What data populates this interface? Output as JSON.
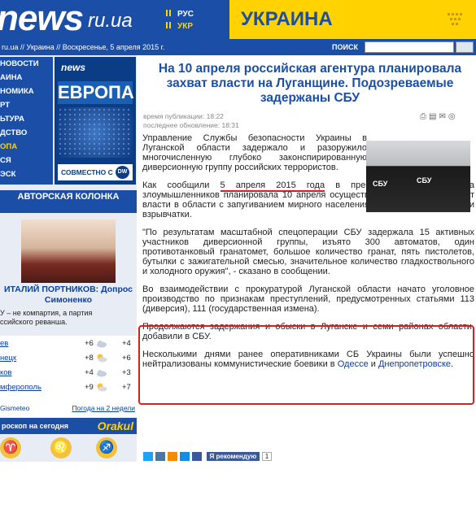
{
  "header": {
    "logo_main": "news",
    "logo_suffix": "ru.ua",
    "lang_ru": "РУС",
    "lang_ua": "УКР",
    "section_title": "УКРАИНА"
  },
  "crumbs": "ru.ua // Украина // Воскресенье, 5 апреля 2015 г.",
  "search_label": "ПОИСК",
  "sidebar": {
    "nav": [
      "НОВОСТИ",
      "АИНА",
      "НОМИКА",
      "РТ",
      "ЬТУРА",
      "ДСТВО",
      "ОПА",
      "СЯ",
      "ЭСК"
    ],
    "active_index": 6,
    "europe": {
      "logo": "news",
      "title": "ЕВРОПА",
      "foot": "СОВМЕСТНО С",
      "dw": "DW"
    },
    "author_title": "АВТОРСКАЯ КОЛОНКА",
    "author_name": "ИТАЛИЙ ПОРТНИКОВ: Допрос Симоненко",
    "author_teaser": "У – не компартия, а партия\nссийского реванша.",
    "weather": [
      {
        "city": "ев",
        "t1": "+6",
        "t2": "+4"
      },
      {
        "city": "нецк",
        "t1": "+8",
        "t2": "+6"
      },
      {
        "city": "ков",
        "t1": "+4",
        "t2": "+3"
      },
      {
        "city": "мферополь",
        "t1": "+9",
        "t2": "+7"
      }
    ],
    "weather_source": "Gismeteo",
    "weather_forecast": "Погода на 2 недели",
    "horoscope_title": "роскоп на сегодня",
    "horoscope_brand": "Orakul",
    "zodiac": [
      "♈",
      "♌",
      "♐"
    ]
  },
  "article": {
    "title": "На 10 апреля российская агентура планировала захват власти на Луганщине. Подозреваемые задержаны СБУ",
    "published": "время публикации: 18:22",
    "updated": "последнее обновление: 18:31",
    "p1": "Управление Службы безопасности Украины в Луганской области задержало и разоружило многочисленную глубоко законспирированную диверсионную группу российских террористов.",
    "p2_before": "Как сообщили ",
    "p2_date": "5 апреля 2015 года",
    "p2_after": " в пресс-центре СБУ, группа злоумышленников планировала 10 апреля осуществить вооруженный захват власти в области с запугиванием мирного населения, применением оружия и взрывчатки.",
    "p3": "\"По результатам масштабной спецоперации СБУ задержала 15 активных участников диверсионной группы, изъято 300 автоматов, один противотанковый гранатомет, большое количество гранат, пять пистолетов, бутылки с зажигательной смесью, значительное количество гладкоствольного и холодного оружия\", - сказано в сообщении.",
    "p4": "Во взаимодействии с прокуратурой Луганской области начато уголовное производство по признакам преступлений, предусмотренных статьями 113 (диверсия), 111 (государственная измена).",
    "p5": "Продолжаются задержания и обыски в Луганске и семи районах области, добавили в СБУ.",
    "p6_before": "Несколькими днями ранее оперативниками СБ Украины были успешно нейтрализованы коммунистические боевики в ",
    "p6_link1": "Одессе",
    "p6_mid": " и ",
    "p6_link2": "Днепропетровске",
    "p6_end": ".",
    "photo_label": "СБУ",
    "recommend": "Я рекомендую",
    "recommend_count": "1"
  },
  "colors": {
    "brand_blue": "#1b4fa7",
    "accent_yellow": "#ffd200",
    "highlight_red": "#d81f1f"
  }
}
